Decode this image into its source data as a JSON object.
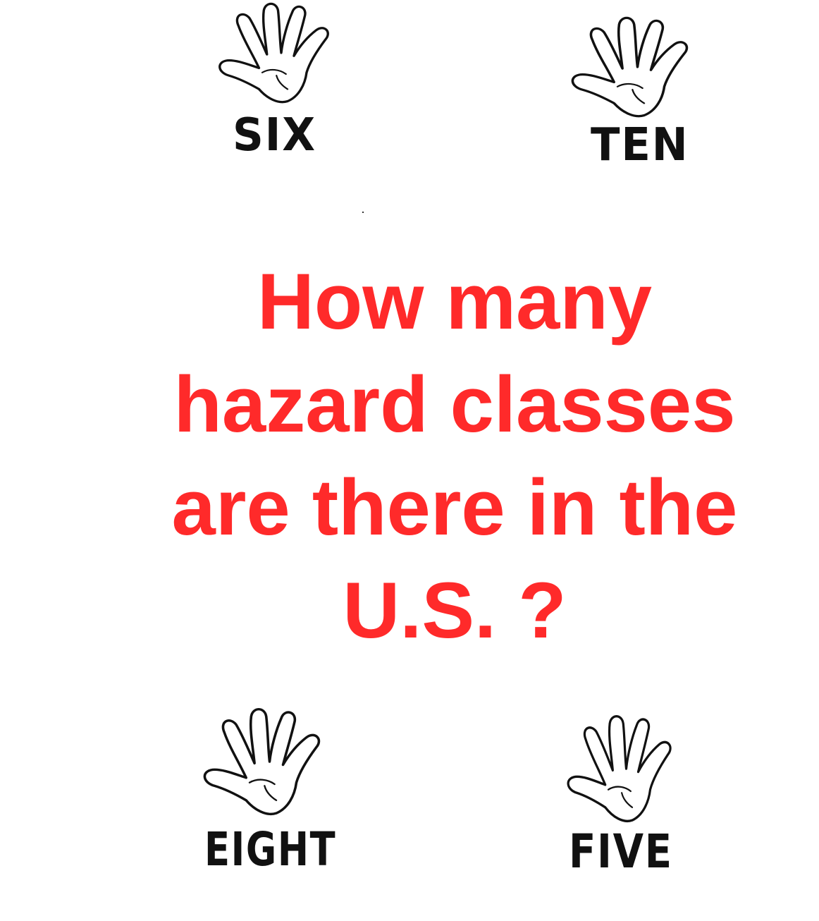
{
  "question": {
    "lines": [
      "How many",
      "hazard classes",
      "are there in the",
      "U.S. ?"
    ]
  },
  "options": {
    "top_left": {
      "label": "SIX",
      "icon": "hand-icon"
    },
    "top_right": {
      "label": "TEN",
      "icon": "hand-icon"
    },
    "bottom_left": {
      "label": "EIGHT",
      "icon": "hand-icon"
    },
    "bottom_right": {
      "label": "FIVE",
      "icon": "hand-icon"
    }
  },
  "colors": {
    "question_text": "#ff2a2a",
    "label_text": "#111111",
    "hand_outline": "#111111",
    "background": "#ffffff"
  }
}
